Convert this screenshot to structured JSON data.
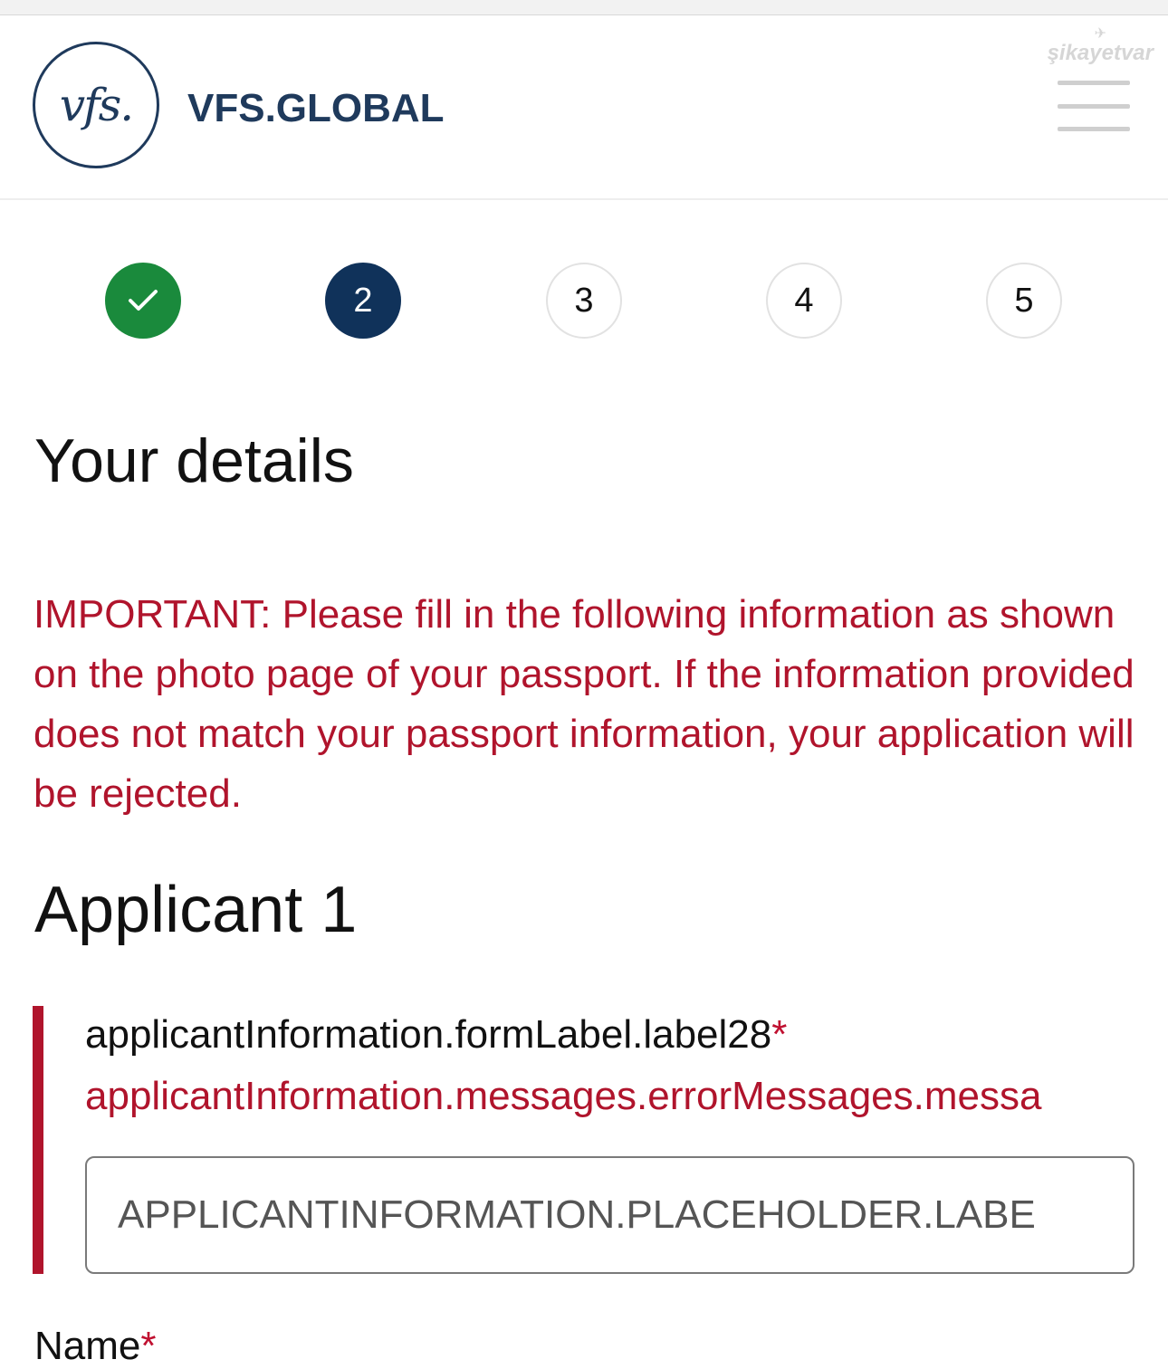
{
  "header": {
    "logo_mark": "vfs.",
    "brand_name": "VFS.GLOBAL",
    "watermark": "şikayetvar",
    "menu_icon": "hamburger-menu-icon"
  },
  "stepper": {
    "steps": [
      {
        "label": "",
        "state": "completed",
        "icon": "checkmark-icon"
      },
      {
        "label": "2",
        "state": "current"
      },
      {
        "label": "3",
        "state": "pending"
      },
      {
        "label": "4",
        "state": "pending"
      },
      {
        "label": "5",
        "state": "pending"
      }
    ]
  },
  "main": {
    "title": "Your details",
    "important_notice": "IMPORTANT: Please fill in the following information as shown on the photo page of your passport. If the information provided does not match your passport information, your application will be rejected.",
    "applicant_title": "Applicant 1"
  },
  "form": {
    "field1": {
      "label": "applicantInformation.formLabel.label28",
      "required_marker": "*",
      "error": "applicantInformation.messages.errorMessages.messa",
      "placeholder": "APPLICANTINFORMATION.PLACEHOLDER.LABE",
      "value": ""
    },
    "field2": {
      "label": "Name",
      "required_marker": "*"
    }
  },
  "colors": {
    "brand": "#1f3a5c",
    "step_done": "#1a8a3c",
    "step_current": "#10325a",
    "error": "#b0142c"
  }
}
